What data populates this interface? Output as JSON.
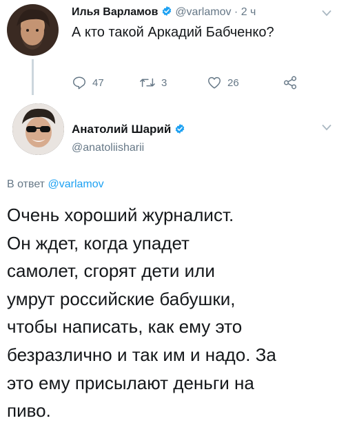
{
  "colors": {
    "text": "#14171a",
    "secondary": "#657786",
    "link": "#1da1f2",
    "verified": "#1da1f2",
    "thread_line": "#ccd6dd"
  },
  "tweet1": {
    "author_name": "Илья Варламов",
    "verified": true,
    "handle": "@varlamov",
    "separator": "·",
    "time": "2 ч",
    "text": "А кто такой Аркадий Бабченко?",
    "actions": {
      "reply_icon": "reply-icon",
      "reply_count": "47",
      "retweet_icon": "retweet-icon",
      "retweet_count": "3",
      "like_icon": "heart-icon",
      "like_count": "26",
      "share_icon": "share-icon"
    },
    "menu_icon": "chevron-down-icon"
  },
  "tweet2": {
    "author_name": "Анатолий Шарий",
    "verified": true,
    "handle": "@anatoliisharii",
    "menu_icon": "chevron-down-icon",
    "reply_prefix": "В ответ",
    "reply_to": "@varlamov",
    "text_lines": [
      "Очень хороший журналист.",
      "Он ждет, когда упадет",
      "самолет, сгорят дети или",
      "умрут российские бабушки,",
      "чтобы написать, как ему это",
      "безразлично и так им и надо. За",
      "это ему присылают деньги на",
      "пиво."
    ]
  }
}
